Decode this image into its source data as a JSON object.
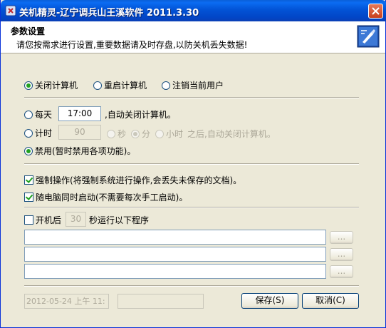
{
  "window": {
    "title": "关机精灵-辽宁调兵山王溪软件  2011.3.30"
  },
  "header": {
    "title": "参数设置",
    "subtitle": "请您按需求进行设置,重要数据请及时存盘,以防关机丢失数据!"
  },
  "action_options": {
    "shutdown": "关闭计算机",
    "restart": "重启计算机",
    "logoff": "注销当前用户",
    "selected": "shutdown"
  },
  "schedule": {
    "daily_label": "每天",
    "daily_time": "17:00",
    "daily_suffix": ",自动关闭计算机。",
    "timer_label": "计时",
    "timer_value": "90",
    "unit_sec": "秒",
    "unit_min": "分",
    "unit_hour": "小时",
    "timer_suffix": "之后,自动关闭计算机。",
    "disabled_label": "禁用(暂时禁用各项功能)。",
    "selected": "disabled",
    "selected_unit": "min"
  },
  "options": {
    "force_label": "强制操作(将强制系统进行操作,会丢失未保存的文档)。",
    "force_checked": true,
    "startup_label": "随电脑同时启动(不需要每次手工启动)。",
    "startup_checked": true
  },
  "startup_programs": {
    "label_prefix": "开机后",
    "delay_seconds": "30",
    "label_suffix": "秒运行以下程序",
    "enabled": false,
    "programs": [
      "",
      "",
      ""
    ],
    "browse_label": "..."
  },
  "footer": {
    "datetime": "2012-05-24 上午 11:",
    "status": "",
    "save_label": "保存(S)",
    "cancel_label": "取消(C)"
  }
}
